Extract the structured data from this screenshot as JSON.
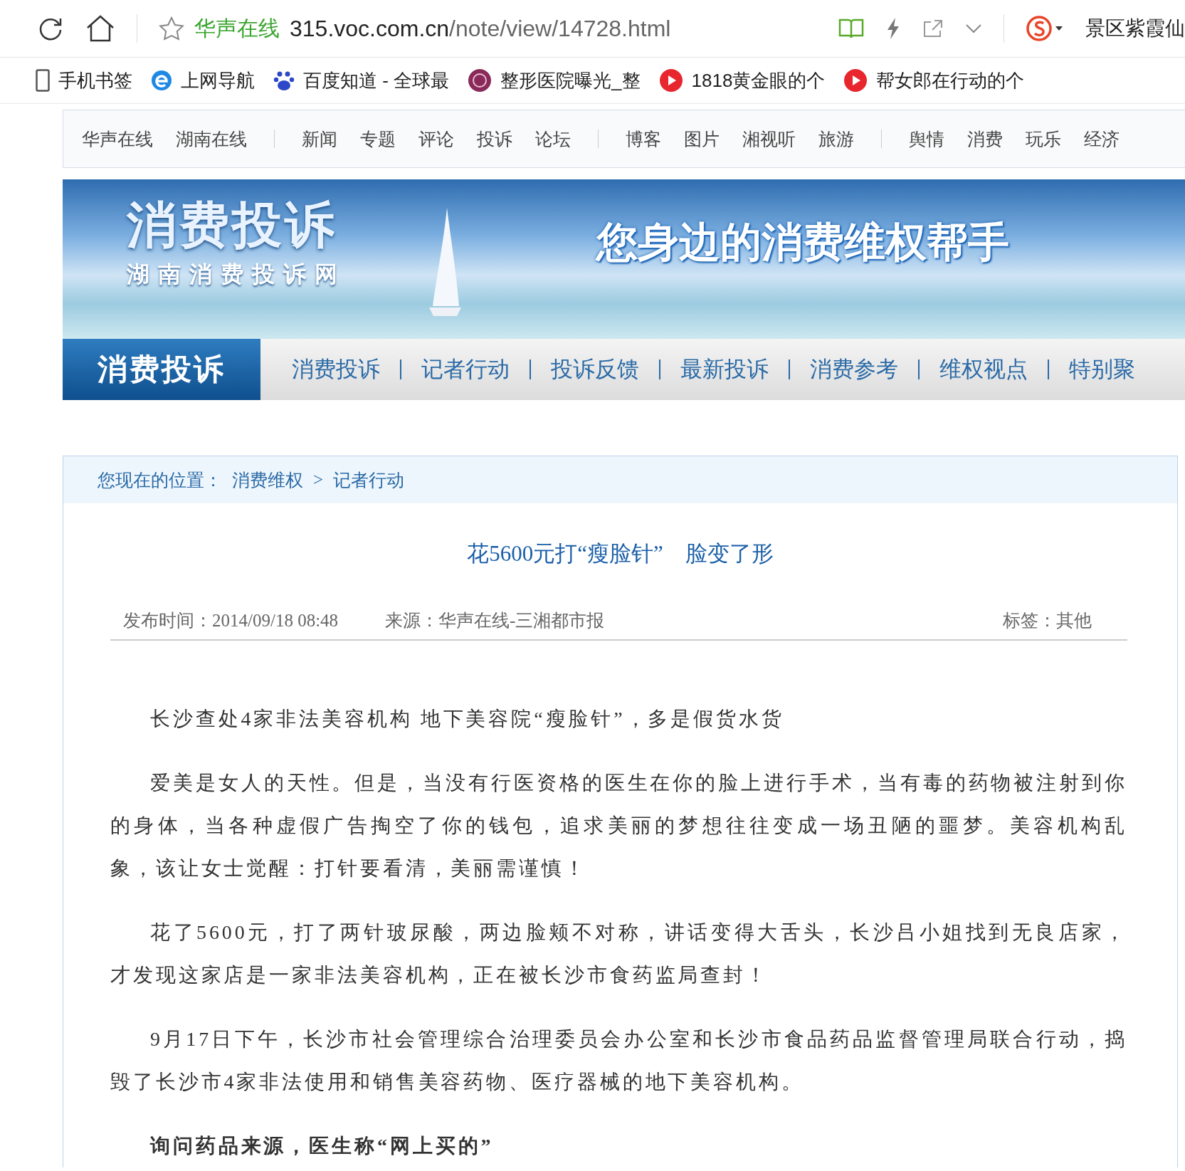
{
  "browser": {
    "site_name": "华声在线",
    "url_host": "315.voc.com.cn",
    "url_path": "/note/view/14728.html",
    "search_text": "景区紫霞仙"
  },
  "bookmarks": [
    {
      "label": "手机书签",
      "kind": "phone"
    },
    {
      "label": "上网导航",
      "kind": "ie"
    },
    {
      "label": "百度知道 - 全球最",
      "kind": "paw"
    },
    {
      "label": "整形医院曝光_整",
      "kind": "clinic"
    },
    {
      "label": "1818黄金眼的个",
      "kind": "play"
    },
    {
      "label": "帮女郎在行动的个",
      "kind": "play"
    }
  ],
  "site_nav": [
    [
      "华声在线",
      "湖南在线"
    ],
    [
      "新闻",
      "专题",
      "评论",
      "投诉",
      "论坛"
    ],
    [
      "博客",
      "图片",
      "湘视听",
      "旅游"
    ],
    [
      "舆情",
      "消费",
      "玩乐",
      "经济"
    ]
  ],
  "banner": {
    "title": "消费投诉",
    "subtitle": "湖南消费投诉网",
    "slogan": "您身边的消费维权帮手"
  },
  "section_nav": {
    "brand": "消费投诉",
    "items": [
      "消费投诉",
      "记者行动",
      "投诉反馈",
      "最新投诉",
      "消费参考",
      "维权视点",
      "特别聚"
    ]
  },
  "breadcrumb": {
    "prefix": "您现在的位置：",
    "items": [
      "消费维权",
      "记者行动"
    ],
    "separator": ">"
  },
  "article": {
    "title": "花5600元打“瘦脸针”　脸变了形",
    "published": "发布时间：2014/09/18 08:48",
    "source": "来源：华声在线-三湘都市报",
    "tags": "标签：其他",
    "paragraphs": [
      {
        "kind": "text",
        "text": "长沙查处4家非法美容机构 地下美容院“瘦脸针”，多是假货水货"
      },
      {
        "kind": "text",
        "text": "爱美是女人的天性。但是，当没有行医资格的医生在你的脸上进行手术，当有毒的药物被注射到你的身体，当各种虚假广告掏空了你的钱包，追求美丽的梦想往往变成一场丑陋的噩梦。美容机构乱象，该让女士觉醒：打针要看清，美丽需谨慎！"
      },
      {
        "kind": "text",
        "text": "花了5600元，打了两针玻尿酸，两边脸颊不对称，讲话变得大舌头，长沙吕小姐找到无良店家，才发现这家店是一家非法美容机构，正在被长沙市食药监局查封！"
      },
      {
        "kind": "text",
        "text": "9月17日下午，长沙市社会管理综合治理委员会办公室和长沙市食品药品监督管理局联合行动，捣毁了长沙市4家非法使用和销售美容药物、医疗器械的地下美容机构。"
      },
      {
        "kind": "subheading",
        "text": "询问药品来源，医生称“网上买的”"
      }
    ]
  }
}
